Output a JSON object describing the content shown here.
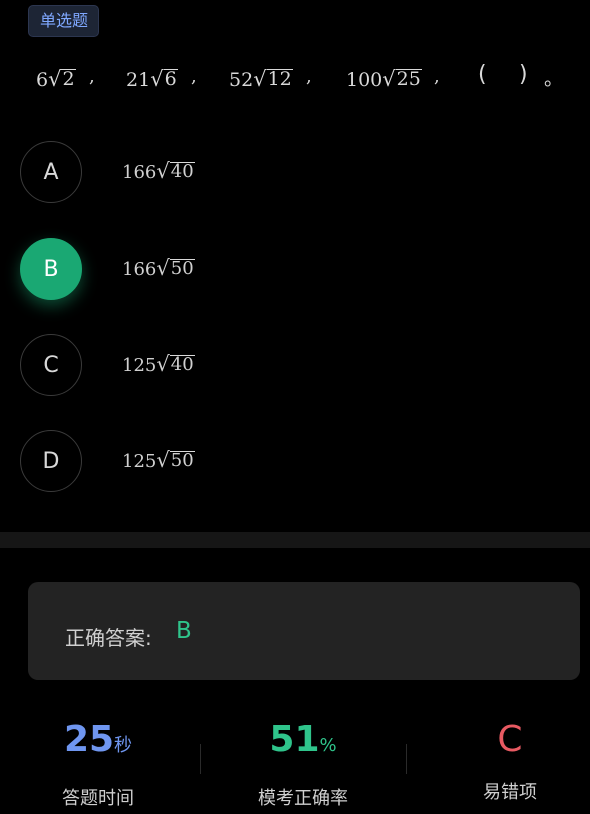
{
  "question": {
    "type_label": "单选题",
    "terms": [
      {
        "coef": "6",
        "radicand": "2"
      },
      {
        "coef": "21",
        "radicand": "6"
      },
      {
        "coef": "52",
        "radicand": "12"
      },
      {
        "coef": "100",
        "radicand": "25"
      }
    ],
    "separator": ",",
    "blank_open": "(",
    "blank_close": ")",
    "period": "。"
  },
  "options": [
    {
      "letter": "A",
      "coef": "166",
      "radicand": "40",
      "selected": false
    },
    {
      "letter": "B",
      "coef": "166",
      "radicand": "50",
      "selected": true
    },
    {
      "letter": "C",
      "coef": "125",
      "radicand": "40",
      "selected": false
    },
    {
      "letter": "D",
      "coef": "125",
      "radicand": "50",
      "selected": false
    }
  ],
  "answer": {
    "label": "正确答案:",
    "value": "B"
  },
  "stats": {
    "time": {
      "value": "25",
      "unit": "秒",
      "label": "答题时间",
      "color": "#6f96f0"
    },
    "accuracy": {
      "value": "51",
      "unit": "%",
      "label": "模考正确率",
      "color": "#2fc48b"
    },
    "error": {
      "value": "C",
      "label": "易错项",
      "color": "#e85a62"
    }
  },
  "colors": {
    "accent_green": "#1aa873",
    "tag_blue": "#7fa8ff"
  }
}
